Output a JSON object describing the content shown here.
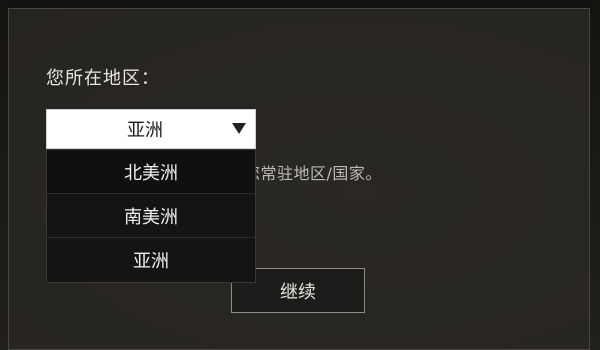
{
  "dialog": {
    "title": "您所在地区：",
    "hint": "为了改进游戏体验，请输入您常驻地区/国家。",
    "continue_label": "继续"
  },
  "region_select": {
    "selected": "亚洲",
    "options": [
      "北美洲",
      "南美洲",
      "亚洲"
    ]
  },
  "icons": {
    "dropdown_arrow": "caret-down-icon"
  },
  "colors": {
    "dialog_bg": "#2a2723",
    "select_bg": "#ffffff",
    "dropdown_bg": "#151413",
    "text_light": "#e8e6e1"
  }
}
